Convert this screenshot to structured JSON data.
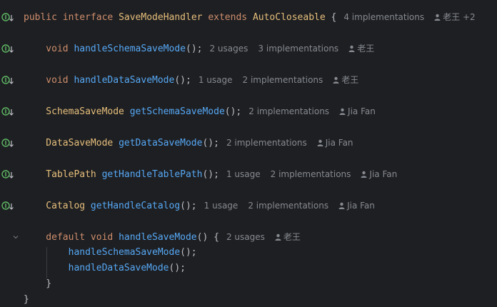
{
  "editor": {
    "lines": [
      {
        "tokens": [
          {
            "t": "public ",
            "c": "kw"
          },
          {
            "t": "interface ",
            "c": "kw"
          },
          {
            "t": "SaveModeHandler ",
            "c": "ty"
          },
          {
            "t": "extends ",
            "c": "kw"
          },
          {
            "t": "AutoCloseable",
            "c": "ty"
          },
          {
            "t": " {",
            "c": "pn"
          }
        ],
        "hints": [
          "4 implementations"
        ],
        "author": "老王 +2",
        "gutter": "impl"
      },
      {
        "tokens": [
          {
            "t": "    void ",
            "c": "kw"
          },
          {
            "t": "handleSchemaSaveMode",
            "c": "fn"
          },
          {
            "t": "();",
            "c": "pn"
          }
        ],
        "hints": [
          "2 usages",
          "3 implementations"
        ],
        "author": "老王",
        "gutter": "impl"
      },
      {
        "tokens": [
          {
            "t": "    void ",
            "c": "kw"
          },
          {
            "t": "handleDataSaveMode",
            "c": "fn"
          },
          {
            "t": "();",
            "c": "pn"
          }
        ],
        "hints": [
          "1 usage",
          "2 implementations"
        ],
        "author": "老王",
        "gutter": "impl"
      },
      {
        "tokens": [
          {
            "t": "    SchemaSaveMode ",
            "c": "ty"
          },
          {
            "t": "getSchemaSaveMode",
            "c": "fn"
          },
          {
            "t": "();",
            "c": "pn"
          }
        ],
        "hints": [
          "2 implementations"
        ],
        "author": "Jia Fan",
        "gutter": "impl"
      },
      {
        "tokens": [
          {
            "t": "    DataSaveMode ",
            "c": "ty"
          },
          {
            "t": "getDataSaveMode",
            "c": "fn"
          },
          {
            "t": "();",
            "c": "pn"
          }
        ],
        "hints": [
          "2 implementations"
        ],
        "author": "Jia Fan",
        "gutter": "impl"
      },
      {
        "tokens": [
          {
            "t": "    TablePath ",
            "c": "ty"
          },
          {
            "t": "getHandleTablePath",
            "c": "fn"
          },
          {
            "t": "();",
            "c": "pn"
          }
        ],
        "hints": [
          "1 usage",
          "2 implementations"
        ],
        "author": "Jia Fan",
        "gutter": "impl"
      },
      {
        "tokens": [
          {
            "t": "    Catalog ",
            "c": "ty"
          },
          {
            "t": "getHandleCatalog",
            "c": "fn"
          },
          {
            "t": "();",
            "c": "pn"
          }
        ],
        "hints": [
          "1 usage",
          "2 implementations"
        ],
        "author": "Jia Fan",
        "gutter": "impl"
      },
      {
        "tokens": [
          {
            "t": "    default ",
            "c": "kw"
          },
          {
            "t": "void ",
            "c": "kw"
          },
          {
            "t": "handleSaveMode",
            "c": "fn"
          },
          {
            "t": "() {",
            "c": "pn"
          }
        ],
        "hints": [
          "2 usages"
        ],
        "author": "老王",
        "gutter": "fold"
      },
      {
        "tokens": [
          {
            "t": "        handleSchemaSaveMode",
            "c": "fd"
          },
          {
            "t": "();",
            "c": "pn"
          }
        ],
        "hints": [],
        "author": "",
        "gutter": ""
      },
      {
        "tokens": [
          {
            "t": "        handleDataSaveMode",
            "c": "fd"
          },
          {
            "t": "();",
            "c": "pn"
          }
        ],
        "hints": [],
        "author": "",
        "gutter": ""
      },
      {
        "tokens": [
          {
            "t": "    }",
            "c": "pn"
          }
        ],
        "hints": [],
        "author": "",
        "gutter": ""
      },
      {
        "tokens": [
          {
            "t": "}",
            "c": "pn"
          }
        ],
        "hints": [],
        "author": "",
        "gutter": ""
      }
    ]
  },
  "colors": {
    "background": "#1e1f22",
    "keyword": "#cf8e6d",
    "type": "#e6bf7c",
    "method": "#56a8f5",
    "hint": "#868a91",
    "gutter_impl": "#5fb865"
  },
  "icons": {
    "gutter_impl": "implementation-marker-icon",
    "author": "user-icon",
    "fold": "chevron-down-icon"
  }
}
